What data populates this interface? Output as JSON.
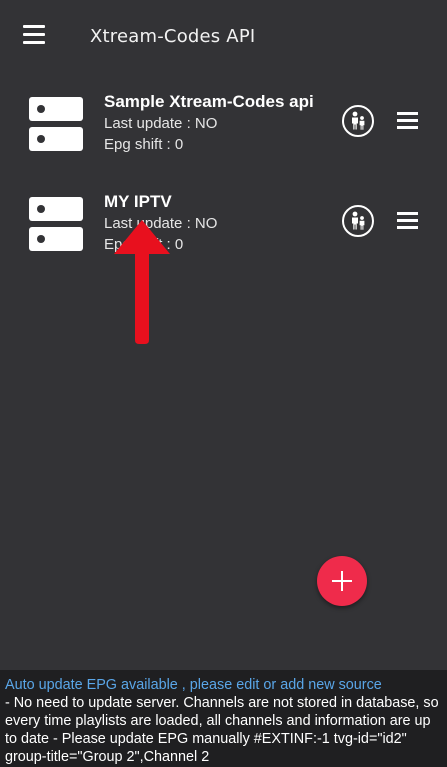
{
  "appbar": {
    "title": "Xtream-Codes API"
  },
  "sources": [
    {
      "name": "Sample Xtream-Codes api",
      "last_update": "Last update : NO",
      "epg_shift": "Epg shift : 0"
    },
    {
      "name": "MY IPTV",
      "last_update": "Last update : NO",
      "epg_shift": "Epg shift : 0"
    }
  ],
  "info": {
    "link_text": "Auto update EPG available , please edit or add new source",
    "details": "- No need to update server. Channels are not stored in database, so every time playlists are loaded, all channels and information are up to date - Please update EPG manually #EXTINF:-1 tvg-id=\"id2\" group-title=\"Group 2\",Channel 2"
  },
  "icons": {
    "nav": "hamburger-menu-icon",
    "source": "server-icon",
    "parental": "parental-control-icon",
    "row_menu": "row-menu-icon",
    "add": "plus-icon"
  },
  "colors": {
    "background": "#333336",
    "accent": "#ef2b4b",
    "link": "#5aa6e8",
    "arrow": "#e8101e",
    "panel": "#1f1f21"
  }
}
